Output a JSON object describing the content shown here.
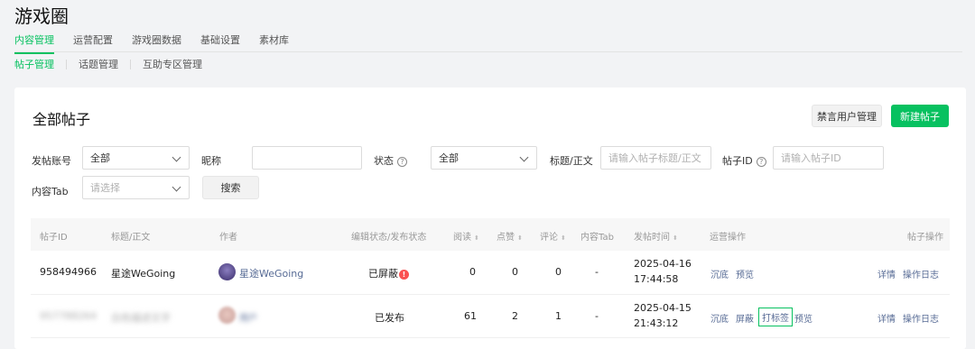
{
  "app": {
    "title": "游戏圈"
  },
  "nav_main": [
    "内容管理",
    "运营配置",
    "游戏圈数据",
    "基础设置",
    "素材库"
  ],
  "nav_sub": [
    "帖子管理",
    "话题管理",
    "互助专区管理"
  ],
  "card": {
    "title": "全部帖子",
    "ban_button": "禁言用户管理",
    "new_button": "新建帖子"
  },
  "filters": {
    "account_label": "发帖账号",
    "account_value": "全部",
    "nickname_label": "昵称",
    "nickname_value": "",
    "status_label": "状态",
    "status_value": "全部",
    "title_label": "标题/正文",
    "title_placeholder": "请输入帖子标题/正文",
    "postid_label": "帖子ID",
    "postid_placeholder": "请输入帖子ID",
    "tab_label": "内容Tab",
    "tab_placeholder": "请选择",
    "search_button": "搜索"
  },
  "table": {
    "headers": {
      "post_id": "帖子ID",
      "title": "标题/正文",
      "author": "作者",
      "status": "编辑状态/发布状态",
      "read": "阅读",
      "like": "点赞",
      "comment": "评论",
      "tab": "内容Tab",
      "time": "发帖时间",
      "ops": "运营操作",
      "post_ops": "帖子操作"
    },
    "sort_glyph": "⬍",
    "rows": [
      {
        "post_id": "958494966",
        "title": "星途WeGoing",
        "author": "星途WeGoing",
        "status": "已屏蔽",
        "read": "0",
        "like": "0",
        "comment": "0",
        "tab": "-",
        "date": "2025-04-16",
        "time": "17:44:58",
        "op1": "沉底",
        "op2": "预览",
        "detail": "详情",
        "log": "操作日志"
      },
      {
        "post_id": "957788264",
        "title": "白色描述文字",
        "author": "用户",
        "status": "已发布",
        "read": "61",
        "like": "2",
        "comment": "1",
        "tab": "-",
        "date": "2025-04-15",
        "time": "21:43:12",
        "op1": "沉底",
        "op2": "屏蔽",
        "op3": "打标签",
        "op4": "预览",
        "detail": "详情",
        "log": "操作日志"
      }
    ]
  },
  "colors": {
    "accent": "#07c160",
    "link": "#576b95",
    "alert": "#fa5151"
  },
  "icons": {
    "help": "question-circle-icon",
    "dropdown": "chevron-down-icon",
    "alert": "exclamation-badge-icon"
  }
}
